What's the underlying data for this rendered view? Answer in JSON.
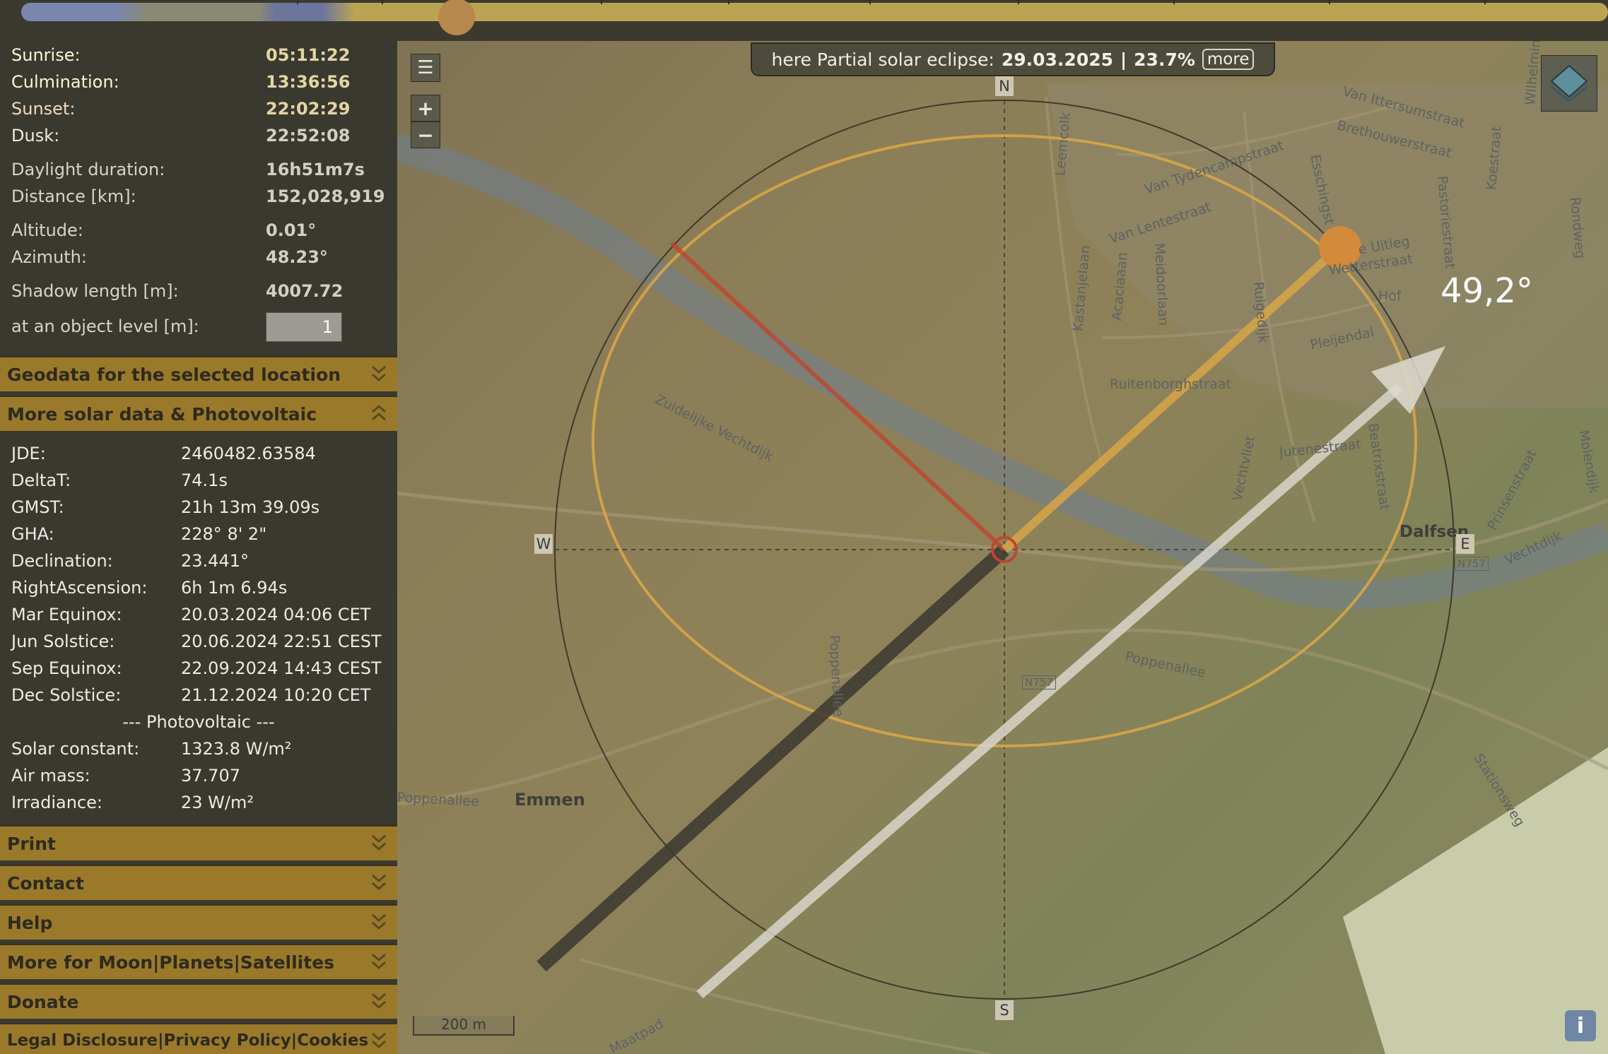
{
  "timeline": {
    "thumb_color": "#b8874d"
  },
  "eclipse": {
    "prefix": "here Partial solar eclipse:",
    "date": "29.03.2025",
    "sep": "|",
    "percent": "23.7%",
    "more": "more"
  },
  "compass": {
    "n": "N",
    "s": "S",
    "w": "W",
    "e": "E"
  },
  "azimuth_label": "49,2°",
  "scale": "200 m",
  "info": "i",
  "map_controls": {
    "zoom_in": "+",
    "zoom_out": "−"
  },
  "streets": [
    "Van Ittersumstraat",
    "Brethouwerstraat",
    "Van Tydencampstraat",
    "Esschingst",
    "Van Lentestraat",
    "Kastanjelaan",
    "Acaciaaan",
    "Meidoorlaan",
    "Ruitenborghstraat",
    "Pleijendal",
    "Wetterstraat",
    "Hof",
    "Zuidelijke Vechtdijk",
    "Poppenallee",
    "Poppenallee",
    "Poppenallee",
    "Emmen",
    "Dalfsen",
    "Vechtdijk",
    "Prinsenstraat",
    "Stationsweg",
    "Beatrixstraat",
    "Jutenestraat",
    "Pastoriestraat",
    "Koestraat",
    "Wilhelminastraat",
    "Rondweg",
    "N757",
    "N757",
    "Maatpad",
    "Molendijk",
    "Leemcolk",
    "Ruigedijk",
    "Vechtvliet",
    "e Uitleg"
  ],
  "sun_times": [
    {
      "label": "Sunrise:",
      "value": "05:11:22"
    },
    {
      "label": "Culmination:",
      "value": "13:36:56"
    },
    {
      "label": "Sunset:",
      "value": "22:02:29"
    },
    {
      "label": "Dusk:",
      "value": "22:52:08"
    }
  ],
  "sun_info": [
    {
      "label": "Daylight duration:",
      "value": "16h51m7s"
    },
    {
      "label": "Distance [km]:",
      "value": "152,028,919"
    },
    {
      "label": "Altitude:",
      "value": "0.01°"
    },
    {
      "label": "Azimuth:",
      "value": "48.23°"
    },
    {
      "label": "Shadow length [m]:",
      "value": "4007.72"
    },
    {
      "label": "at an object level [m]:",
      "value": "1"
    }
  ],
  "sections": {
    "geodata": "Geodata for the selected location",
    "more_solar": "More solar data & Photovoltaic",
    "print": "Print",
    "contact": "Contact",
    "help": "Help",
    "moon": "More for Moon|Planets|Satellites",
    "donate": "Donate",
    "legal": "Legal Disclosure|Privacy Policy|Cookies"
  },
  "solar_data": [
    {
      "label": "JDE:",
      "value": "2460482.63584"
    },
    {
      "label": "DeltaT:",
      "value": "74.1s"
    },
    {
      "label": "GMST:",
      "value": "21h 13m 39.09s"
    },
    {
      "label": "GHA:",
      "value": "228° 8' 2\""
    },
    {
      "label": "Declination:",
      "value": "23.441°"
    },
    {
      "label": "RightAscension:",
      "value": "6h 1m 6.94s"
    },
    {
      "label": "Mar Equinox:",
      "value": "20.03.2024 04:06 CET"
    },
    {
      "label": "Jun Solstice:",
      "value": "20.06.2024 22:51 CEST"
    },
    {
      "label": "Sep Equinox:",
      "value": "22.09.2024 14:43 CEST"
    },
    {
      "label": "Dec Solstice:",
      "value": "21.12.2024 10:20 CET"
    }
  ],
  "photovoltaic_header": "--- Photovoltaic ---",
  "pv_data": [
    {
      "label": "Solar constant:",
      "value": "1323.8 W/m²"
    },
    {
      "label": "Air mass:",
      "value": "37.707"
    },
    {
      "label": "Irradiance:",
      "value": "23 W/m²"
    }
  ],
  "colors": {
    "accent": "#9a7a2a",
    "sun": "#d38a3a",
    "sunrise_line": "#c0452e",
    "shadow": "#3b3930",
    "path": "#d8a548"
  }
}
